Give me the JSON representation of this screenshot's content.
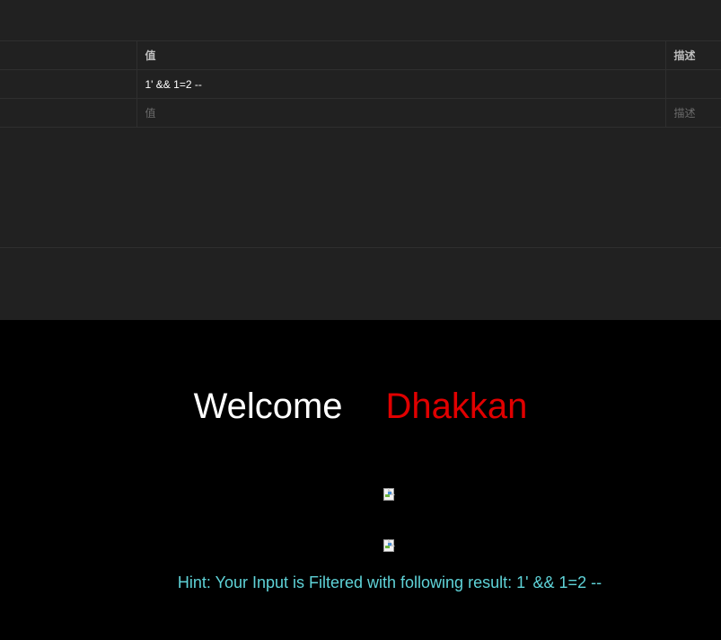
{
  "params_table": {
    "headers": {
      "key": "",
      "value": "值",
      "description": "描述"
    },
    "rows": [
      {
        "key": "",
        "value": "1' && 1=2 --",
        "description": ""
      }
    ],
    "new_row": {
      "key_placeholder": "",
      "value_placeholder": "值",
      "description_placeholder": "描述"
    }
  },
  "response_page": {
    "welcome_word": "Welcome",
    "name": "Dhakkan",
    "hint": "Hint: Your Input is Filtered with following result: 1' && 1=2 --",
    "images": [
      {
        "icon": "broken-image-icon"
      },
      {
        "icon": "broken-image-icon"
      }
    ]
  },
  "colors": {
    "panel_bg": "#212121",
    "page_bg": "#000000",
    "welcome": "#ffffff",
    "name": "#e00000",
    "hint": "#5fd3d8"
  }
}
